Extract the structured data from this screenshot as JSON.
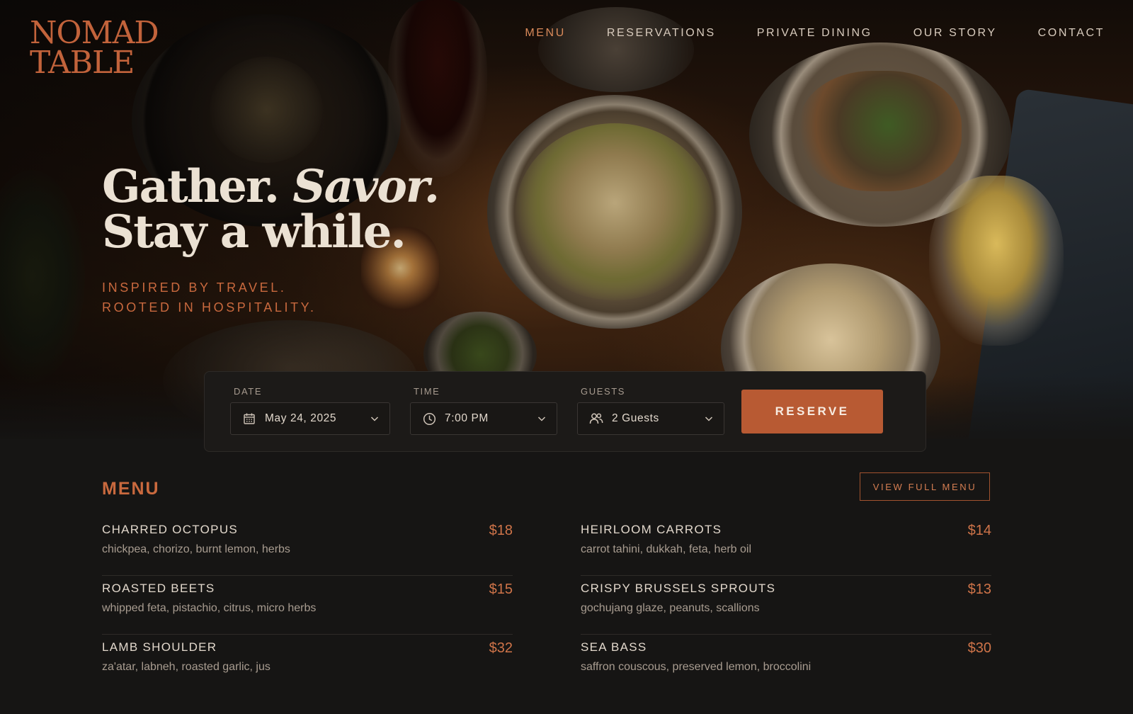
{
  "brand": {
    "line1": "NOMAD",
    "line2": "TABLE"
  },
  "nav": {
    "items": [
      {
        "label": "MENU",
        "active": true
      },
      {
        "label": "RESERVATIONS",
        "active": false
      },
      {
        "label": "PRIVATE DINING",
        "active": false
      },
      {
        "label": "OUR STORY",
        "active": false
      },
      {
        "label": "CONTACT",
        "active": false
      }
    ]
  },
  "hero": {
    "headline_part1": "Gather.",
    "headline_part2": "Savor.",
    "headline_line2": "Stay a while.",
    "tagline_line1": "INSPIRED BY TRAVEL.",
    "tagline_line2": "ROOTED IN HOSPITALITY."
  },
  "reservation": {
    "date": {
      "label": "DATE",
      "value": "May 24, 2025",
      "icon": "calendar-icon"
    },
    "time": {
      "label": "TIME",
      "value": "7:00 PM",
      "icon": "clock-icon"
    },
    "guests": {
      "label": "GUESTS",
      "value": "2 Guests",
      "icon": "guests-icon"
    },
    "button_label": "RESERVE"
  },
  "menu": {
    "title": "MENU",
    "view_full_label": "VIEW FULL MENU",
    "left": [
      {
        "name": "CHARRED OCTOPUS",
        "desc": "chickpea, chorizo, burnt lemon, herbs",
        "price": "$18"
      },
      {
        "name": "ROASTED BEETS",
        "desc": "whipped feta, pistachio, citrus, micro herbs",
        "price": "$15"
      },
      {
        "name": "LAMB SHOULDER",
        "desc": "za'atar, labneh, roasted garlic, jus",
        "price": "$32"
      }
    ],
    "right": [
      {
        "name": "HEIRLOOM CARROTS",
        "desc": "carrot tahini, dukkah, feta, herb oil",
        "price": "$14"
      },
      {
        "name": "CRISPY BRUSSELS SPROUTS",
        "desc": "gochujang glaze, peanuts, scallions",
        "price": "$13"
      },
      {
        "name": "SEA BASS",
        "desc": "saffron couscous, preserved lemon, broccolini",
        "price": "$30"
      }
    ]
  },
  "colors": {
    "accent": "#c2633b",
    "button": "#b85a33",
    "background": "#161514"
  }
}
